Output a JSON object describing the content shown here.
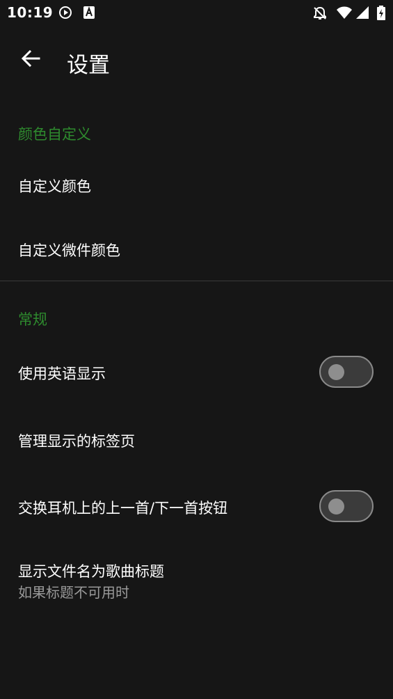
{
  "status_bar": {
    "time": "10:19",
    "icons": [
      "play-circle-icon",
      "a-badge-icon",
      "notifications-off-icon",
      "wifi-icon",
      "signal-icon",
      "battery-charging-icon"
    ]
  },
  "app_bar": {
    "title": "设置",
    "back_icon": "arrow-back-icon"
  },
  "sections": {
    "color": {
      "header": "颜色自定义",
      "items": [
        {
          "title": "自定义颜色"
        },
        {
          "title": "自定义微件颜色"
        }
      ]
    },
    "general": {
      "header": "常规",
      "items": [
        {
          "title": "使用英语显示",
          "switch_on": false
        },
        {
          "title": "管理显示的标签页"
        },
        {
          "title": "交换耳机上的上一首/下一首按钮",
          "switch_on": false
        },
        {
          "title": "显示文件名为歌曲标题",
          "summary": "如果标题不可用时"
        }
      ]
    }
  },
  "colors": {
    "background": "#161616",
    "accent_header": "#2e8b2e",
    "text_primary": "#ffffff",
    "text_secondary": "#9a9a9a"
  }
}
